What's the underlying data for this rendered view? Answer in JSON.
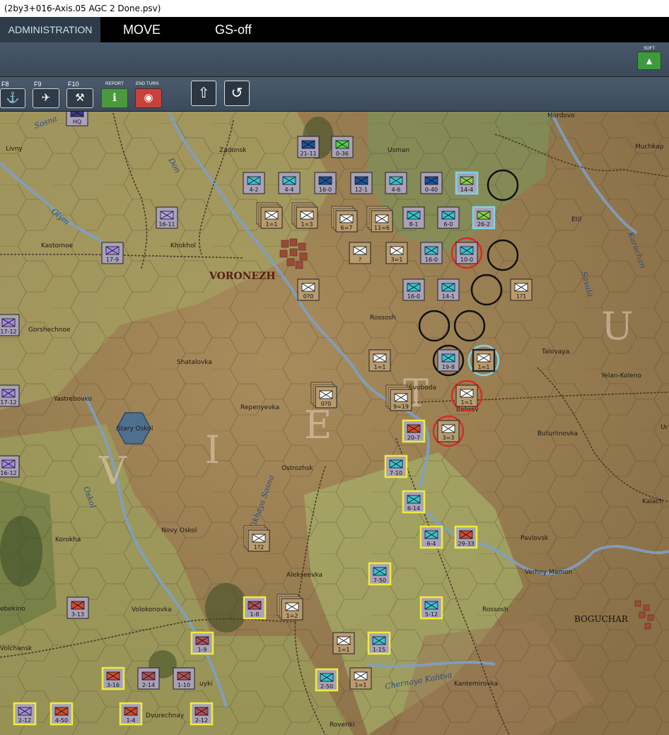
{
  "window": {
    "title": "(2by3+016-Axis.05 AGC 2 Done.psv)"
  },
  "menu": {
    "admin": "ADMINISTRATION",
    "move": "MOVE",
    "gs": "GS-off"
  },
  "panel": {
    "soft_label": "SOFT",
    "soft_icon": "water-drop-icon"
  },
  "toolbar": {
    "f8": "F8",
    "f9": "F9",
    "f10": "F10",
    "report": "REPORT",
    "end_turn": "END TURN",
    "f8_icon": "artillery-icon",
    "f9_icon": "air-strike-icon",
    "f10_icon": "engineer-icon",
    "report_icon": "info-icon",
    "end_turn_icon": "record-icon",
    "up_icon": "arrow-up-icon",
    "undo_icon": "undo-icon"
  },
  "map": {
    "towns": [
      "Livny",
      "Zadonsk",
      "Usman",
      "Mordovo",
      "Muchkap",
      "Etil",
      "Kastornoe",
      "Khokhol",
      "Gorshechnoe",
      "Rossosh",
      "Talovaya",
      "Yelan-Koleno",
      "Shatalovka",
      "Svoboda",
      "Bobrov",
      "Yastrebovko",
      "Repenyevka",
      "Stary Oskol",
      "Buturlinovka",
      "Ostrozhsk",
      "Kalach",
      "Korokha",
      "Novy Oskol",
      "Pavlovsk",
      "Verhny Mamon",
      "Alekseevka",
      "ebekino",
      "Volokonovka",
      "Rossosh",
      "Volchansk",
      "uyki",
      "Kantemirovka",
      "Dvurechnay",
      "Rovenki",
      "Ur"
    ],
    "city_voronezh": "VORONEZH",
    "city_boguchar": "BOGUCHAR",
    "rivers": [
      "Sosna",
      "Don",
      "Olym",
      "Oskol",
      "Karachan",
      "Savala",
      "Chernaya Kalitva",
      "Tikhaya Sosna"
    ],
    "front_letters": [
      "V",
      "I",
      "E",
      "T",
      "U"
    ],
    "units": [
      {
        "v": "HQ"
      },
      {
        "v": "21-11"
      },
      {
        "v": "0-36"
      },
      {
        "v": "16-11"
      },
      {
        "v": "17-9"
      },
      {
        "v": "4-2"
      },
      {
        "v": "4-4"
      },
      {
        "v": "16-0"
      },
      {
        "v": "12-1"
      },
      {
        "v": "4-6"
      },
      {
        "v": "0-40"
      },
      {
        "v": "14-4"
      },
      {
        "v": "1=1"
      },
      {
        "v": "1=3"
      },
      {
        "v": "6=7"
      },
      {
        "v": "11=6"
      },
      {
        "v": "8-1"
      },
      {
        "v": "6-0"
      },
      {
        "v": "26-2"
      },
      {
        "v": "?"
      },
      {
        "v": "3=1"
      },
      {
        "v": "16-0"
      },
      {
        "v": "10-0"
      },
      {
        "v": "0?0"
      },
      {
        "v": "16-0"
      },
      {
        "v": "14-1"
      },
      {
        "v": "1?1"
      },
      {
        "v": "17-12"
      },
      {
        "v": "1=1"
      },
      {
        "v": "19-8"
      },
      {
        "v": "1=1"
      },
      {
        "v": "0?0"
      },
      {
        "v": "9=19"
      },
      {
        "v": "1=1"
      },
      {
        "v": "17-12"
      },
      {
        "v": "20-7"
      },
      {
        "v": "3=3"
      },
      {
        "v": "16-12"
      },
      {
        "v": "7-10"
      },
      {
        "v": "6-14"
      },
      {
        "v": "6-4"
      },
      {
        "v": "29-33"
      },
      {
        "v": "1?2"
      },
      {
        "v": "7-50"
      },
      {
        "v": "3-13"
      },
      {
        "v": "1-8"
      },
      {
        "v": "1=2"
      },
      {
        "v": "5-12"
      },
      {
        "v": "1-9"
      },
      {
        "v": "1=1"
      },
      {
        "v": "1-15"
      },
      {
        "v": "3-16"
      },
      {
        "v": "2-14"
      },
      {
        "v": "1-10"
      },
      {
        "v": "2-50"
      },
      {
        "v": "1=1"
      },
      {
        "v": "2-12"
      },
      {
        "v": "4-50"
      },
      {
        "v": "1-4"
      },
      {
        "v": "2-12"
      }
    ]
  }
}
